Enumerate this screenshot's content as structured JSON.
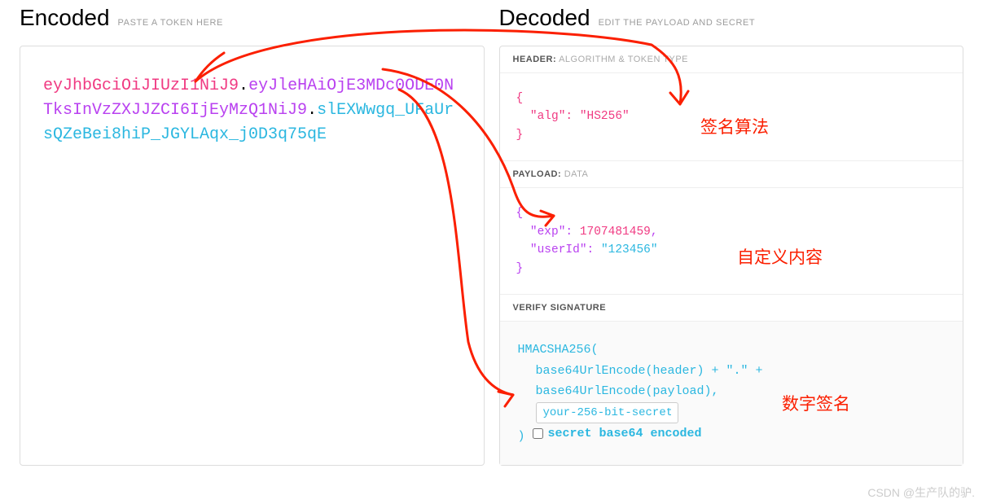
{
  "encoded": {
    "title": "Encoded",
    "subtitle": "PASTE A TOKEN HERE",
    "token": {
      "header": "eyJhbGciOiJIUzI1NiJ9",
      "payload": "eyJleHAiOjE3MDc0ODE0NTksInVzZXJJZCI6IjEyMzQ1NiJ9",
      "signature": "slEXWwgq_UFaUrsQZeBei8hiP_JGYLAqx_j0D3q75qE"
    }
  },
  "decoded": {
    "title": "Decoded",
    "subtitle": "EDIT THE PAYLOAD AND SECRET",
    "header_label": "HEADER:",
    "header_sub": "ALGORITHM & TOKEN TYPE",
    "header_json": {
      "alg_key": "\"alg\"",
      "alg_val": "\"HS256\""
    },
    "payload_label": "PAYLOAD:",
    "payload_sub": "DATA",
    "payload_json": {
      "exp_key": "\"exp\"",
      "exp_val": "1707481459",
      "uid_key": "\"userId\"",
      "uid_val": "\"123456\""
    },
    "signature_label": "VERIFY SIGNATURE",
    "signature": {
      "fn": "HMACSHA256(",
      "line1": "base64UrlEncode(header) + \".\" +",
      "line2": "base64UrlEncode(payload),",
      "secret": "your-256-bit-secret",
      "close": ")",
      "checkbox_label": "secret base64 encoded"
    }
  },
  "annotations": {
    "a1": "签名算法",
    "a2": "自定义内容",
    "a3": "数字签名"
  },
  "watermark": "CSDN @生产队的驴."
}
